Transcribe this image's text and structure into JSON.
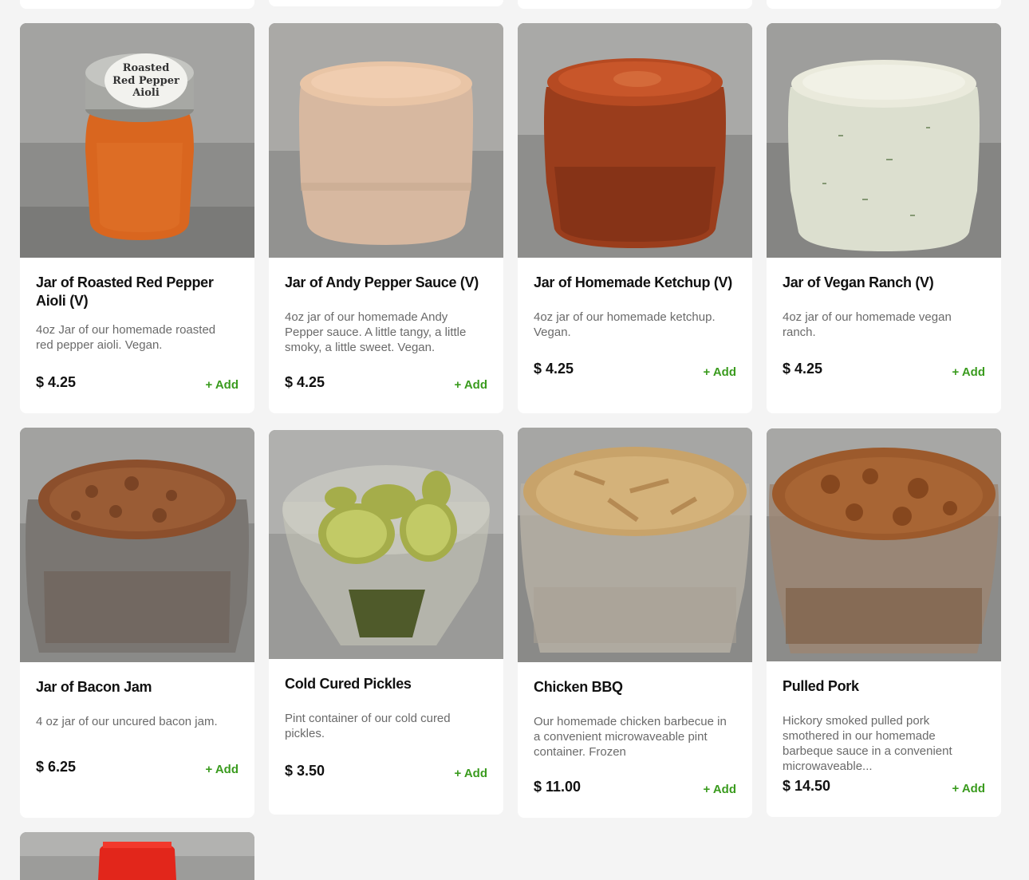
{
  "products": [
    {
      "title": "Jar of Roasted Red Pepper Aioli (V)",
      "description": "4oz Jar of our homemade roasted red pepper aioli. Vegan.",
      "price": "$ 4.25",
      "add_label": "+ Add",
      "lid_label": "Roasted Red Pepper Aioli",
      "lid_lines": [
        "Roasted",
        "Red Pepper",
        "Aioli"
      ],
      "image": "jar-aioli"
    },
    {
      "title": "Jar of Andy Pepper Sauce (V)",
      "description": "4oz jar of our homemade Andy Pepper sauce. A little tangy, a little smoky, a little sweet. Vegan.",
      "price": "$ 4.25",
      "add_label": "+ Add",
      "image": "jar-andy-pepper-sauce"
    },
    {
      "title": "Jar of Homemade Ketchup (V)",
      "description": "4oz jar of our homemade ketchup. Vegan.",
      "price": "$ 4.25",
      "add_label": "+ Add",
      "image": "jar-ketchup"
    },
    {
      "title": "Jar of Vegan Ranch (V)",
      "description": "4oz jar of our homemade vegan ranch.",
      "price": "$ 4.25",
      "add_label": "+ Add",
      "image": "jar-vegan-ranch"
    },
    {
      "title": "Jar of Bacon Jam",
      "description": "4 oz jar of our uncured bacon jam.",
      "price": "$ 6.25",
      "add_label": "+ Add",
      "image": "jar-bacon-jam"
    },
    {
      "title": "Cold Cured Pickles",
      "description": "Pint container of our cold cured pickles.",
      "price": "$ 3.50",
      "add_label": "+ Add",
      "image": "container-pickles"
    },
    {
      "title": "Chicken BBQ",
      "description": "Our homemade chicken barbecue in a convenient microwaveable pint container. Frozen",
      "price": "$ 11.00",
      "add_label": "+ Add",
      "image": "container-chicken-bbq"
    },
    {
      "title": "Pulled Pork",
      "description": "Hickory smoked pulled pork smothered in our homemade barbeque sauce in a convenient microwaveable...",
      "price": "$ 14.50",
      "add_label": "+ Add",
      "image": "container-pulled-pork"
    }
  ],
  "colors": {
    "accent": "#3a9b1e",
    "background": "#f4f4f4",
    "card": "#ffffff"
  }
}
